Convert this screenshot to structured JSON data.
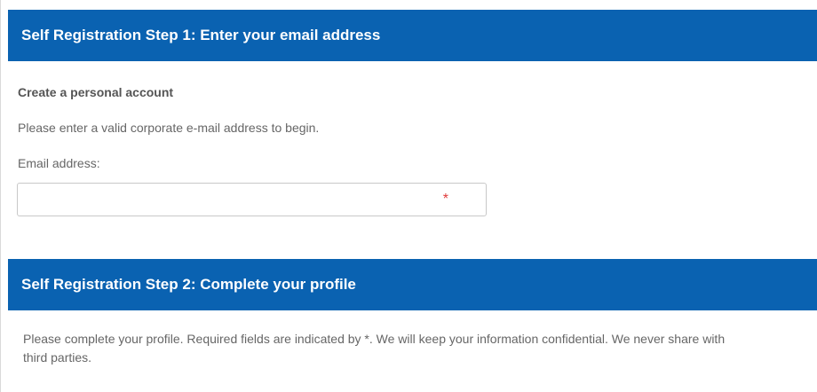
{
  "step1": {
    "header": "Self Registration Step 1: Enter your email address",
    "subtitle": "Create a personal account",
    "instruction": "Please enter a valid corporate e-mail address to begin.",
    "email_label": "Email address:",
    "email_value": "",
    "email_placeholder": "",
    "required_marker": "*"
  },
  "step2": {
    "header": "Self Registration Step 2: Complete your profile",
    "description": "Please complete your profile. Required fields are indicated by *. We will keep your information confidential. We never share with third parties."
  },
  "colors": {
    "header_bg": "#0a62b1",
    "header_text": "#ffffff",
    "required": "#e03a3a",
    "body_text": "#666666"
  }
}
